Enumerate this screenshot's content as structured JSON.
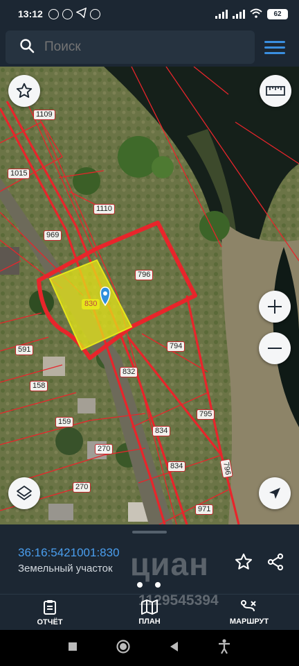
{
  "status_bar": {
    "time": "13:12",
    "battery": "62"
  },
  "search": {
    "placeholder": "Поиск"
  },
  "map": {
    "parcels": [
      "1109",
      "1015",
      "1110",
      "969",
      "796",
      "830",
      "794",
      "591",
      "832",
      "158",
      "159",
      "795",
      "834",
      "270",
      "834",
      "796",
      "270",
      "971"
    ],
    "selected_parcel": "830"
  },
  "info": {
    "cadastral_number": "36:16:5421001:830",
    "land_type": "Земельный участок",
    "watermark": "циан",
    "watermark_sub": "1129545394"
  },
  "nav": {
    "report": "ОТЧЁТ",
    "plan": "ПЛАН",
    "route": "МАРШРУТ"
  },
  "colors": {
    "accent": "#4a9eee",
    "bar_bg": "#1c2733",
    "parcel_line": "#e8252b",
    "selection": "#e6e61a"
  }
}
